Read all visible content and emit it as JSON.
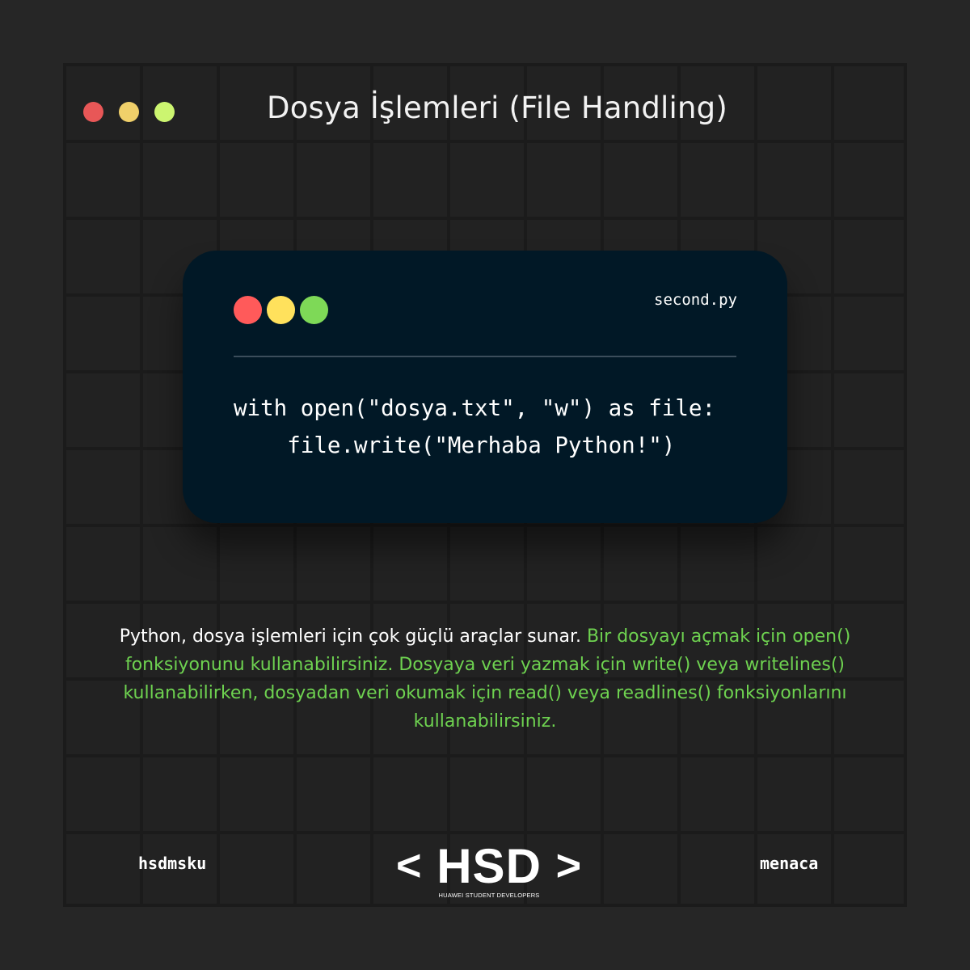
{
  "header": {
    "title": "Dosya İşlemleri (File Handling)",
    "dot_colors": [
      "#e85757",
      "#f0d06a",
      "#ccf570"
    ]
  },
  "code_window": {
    "filename": "second.py",
    "dot_colors": [
      "#ff5a5a",
      "#ffe15c",
      "#7ed957"
    ],
    "code_lines": [
      "with open(\"dosya.txt\", \"w\") as file:",
      "    file.write(\"Merhaba Python!\")"
    ]
  },
  "description": {
    "plain": "Python, dosya işlemleri için çok güçlü araçlar sunar.",
    "highlight": "Bir dosyayı açmak için open() fonksiyonunu kullanabilirsiniz. Dosyaya veri yazmak için write() veya writelines() kullanabilirken, dosyadan veri okumak için read() veya readlines() fonksiyonlarını kullanabilirsiniz.",
    "highlight_color": "#6ed250"
  },
  "footer": {
    "left_handle": "hsdmsku",
    "right_handle": "menaca",
    "logo": {
      "left_bracket": "<",
      "text": "HSD",
      "right_bracket": ">",
      "subtitle": "HUAWEI STUDENT DEVELOPERS"
    }
  }
}
